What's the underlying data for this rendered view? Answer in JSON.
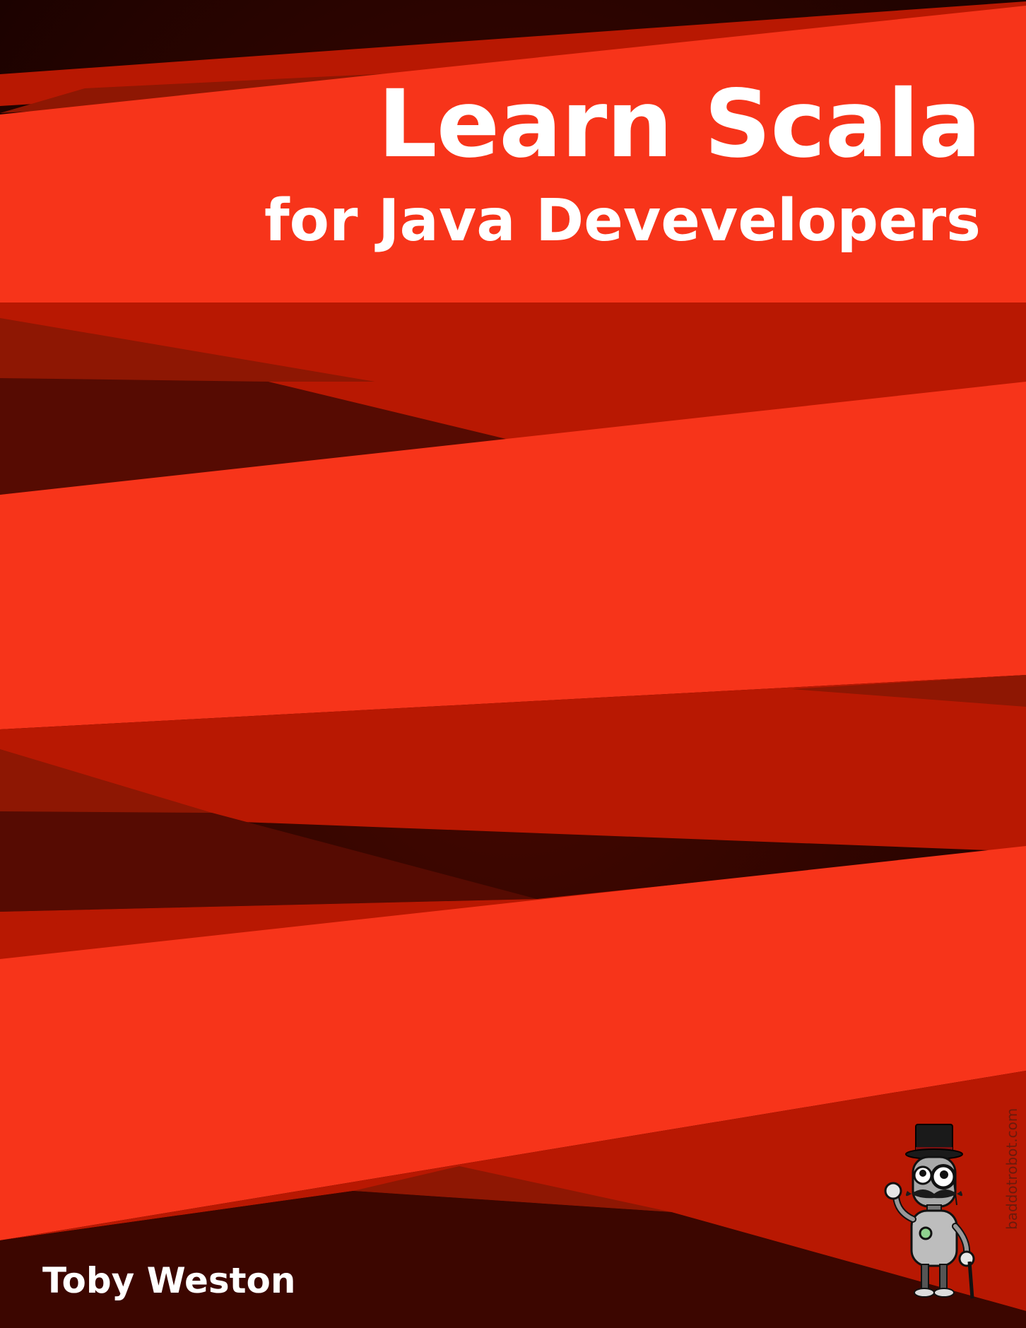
{
  "book": {
    "title": "Learn Scala",
    "subtitle": "for Java Devevelopers",
    "author": "Toby Weston",
    "publisher_mark": "baddotrobot.com"
  },
  "colors": {
    "band_bright": "#f7341a",
    "band_mid": "#b81802",
    "band_dark": "#560b02",
    "background": "#2a0500",
    "text": "#ffffff"
  },
  "icons": {
    "mascot": "top-hat-robot-icon"
  }
}
